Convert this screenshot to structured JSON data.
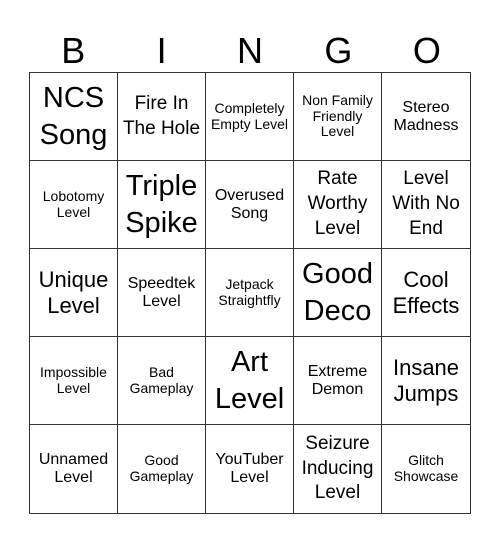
{
  "header": {
    "letters": [
      "B",
      "I",
      "N",
      "G",
      "O"
    ]
  },
  "cells": [
    {
      "text": "NCS Song"
    },
    {
      "text": "Fire In The Hole"
    },
    {
      "text": "Completely Empty Level"
    },
    {
      "text": "Non Family Friendly Level"
    },
    {
      "text": "Stereo Madness"
    },
    {
      "text": "Lobotomy Level"
    },
    {
      "text": "Triple Spike"
    },
    {
      "text": "Overused Song"
    },
    {
      "text": "Rate Worthy Level"
    },
    {
      "text": "Level With No End"
    },
    {
      "text": "Unique Level"
    },
    {
      "text": "Speedtek Level"
    },
    {
      "text": "Jetpack Straightfly"
    },
    {
      "text": "Good Deco"
    },
    {
      "text": "Cool Effects"
    },
    {
      "text": "Impossible Level"
    },
    {
      "text": "Bad Gameplay"
    },
    {
      "text": "Art Level"
    },
    {
      "text": "Extreme Demon"
    },
    {
      "text": "Insane Jumps"
    },
    {
      "text": "Unnamed Level"
    },
    {
      "text": "Good Gameplay"
    },
    {
      "text": "YouTuber Level"
    },
    {
      "text": "Seizure Inducing Level"
    },
    {
      "text": "Glitch Showcase"
    }
  ]
}
